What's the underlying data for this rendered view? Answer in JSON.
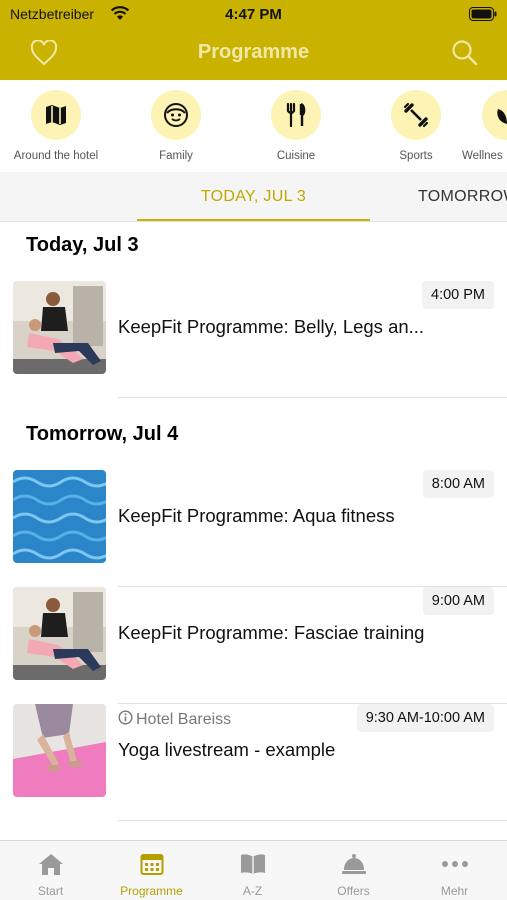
{
  "status_bar": {
    "carrier": "Netzbetreiber",
    "time": "4:47 PM"
  },
  "header": {
    "title": "Programme",
    "left_icon": "heart-icon",
    "right_icon": "search-icon"
  },
  "categories": [
    {
      "label": "Around the hotel",
      "icon": "map-icon"
    },
    {
      "label": "Family",
      "icon": "face-icon"
    },
    {
      "label": "Cuisine",
      "icon": "cutlery-icon"
    },
    {
      "label": "Sports",
      "icon": "dumbbell-icon"
    },
    {
      "label": "Wellnes",
      "icon": "leaf-icon"
    }
  ],
  "date_tabs": [
    {
      "label": "TODAY, JUL 3",
      "active": true
    },
    {
      "label": "TOMORROW",
      "active": false
    }
  ],
  "sections": [
    {
      "title": "Today, Jul 3",
      "events": [
        {
          "time": "4:00 PM",
          "name": "KeepFit Programme: Belly, Legs an...",
          "venue": "",
          "image": "fitness-training-photo"
        }
      ]
    },
    {
      "title": "Tomorrow, Jul 4",
      "events": [
        {
          "time": "8:00 AM",
          "name": "KeepFit Programme: Aqua fitness",
          "venue": "",
          "image": "pool-water-photo"
        },
        {
          "time": "9:00 AM",
          "name": "KeepFit Programme: Fasciae training",
          "venue": "",
          "image": "fitness-training-photo"
        },
        {
          "time": "9:30 AM-10:00 AM",
          "name": "Yoga livestream - example",
          "venue": "Hotel Bareiss",
          "image": "yoga-mat-photo"
        }
      ]
    }
  ],
  "tab_bar": [
    {
      "label": "Start",
      "icon": "house-icon",
      "active": false
    },
    {
      "label": "Programme",
      "icon": "calendar-icon",
      "active": true
    },
    {
      "label": "A-Z",
      "icon": "book-icon",
      "active": false
    },
    {
      "label": "Offers",
      "icon": "service-bell-icon",
      "active": false
    },
    {
      "label": "Mehr",
      "icon": "more-dots-icon",
      "active": false
    }
  ],
  "colors": {
    "brand": "#c9b200",
    "brand_light": "#fcf3b4",
    "active_text": "#c0a800"
  }
}
